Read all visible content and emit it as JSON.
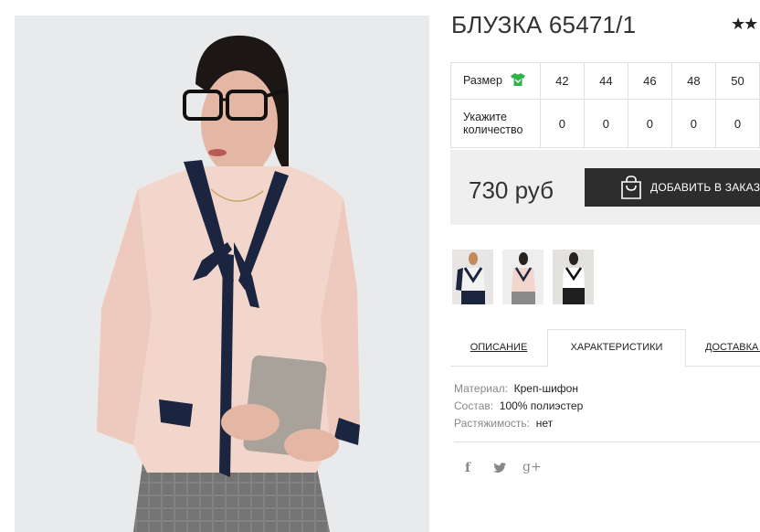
{
  "product": {
    "title": "БЛУЗКА 65471/1",
    "rating_stars": "★★"
  },
  "size_table": {
    "size_label": "Размер",
    "qty_label": "Укажите количество",
    "sizes": [
      "42",
      "44",
      "46",
      "48",
      "50"
    ],
    "quantities": [
      "0",
      "0",
      "0",
      "0",
      "0"
    ],
    "size_chart_icon": "shirt-icon"
  },
  "purchase": {
    "price": "730 руб",
    "order_button": "ДОБАВИТЬ В ЗАКАЗ",
    "order_icon": "shopping-bag-icon"
  },
  "tabs": [
    "ОПИСАНИЕ",
    "ХАРАКТЕРИСТИКИ",
    "ДОСТАВКА И"
  ],
  "active_tab": "ХАРАКТЕРИСТИКИ",
  "specs": [
    {
      "key": "Материал:",
      "value": "Креп-шифон"
    },
    {
      "key": "Состав:",
      "value": "100% полиэстер"
    },
    {
      "key": "Растяжимость:",
      "value": "нет"
    }
  ],
  "social": [
    "f",
    "twitter",
    "g+"
  ],
  "colors": {
    "accent_dark": "#2d2d2d",
    "price_box_bg": "#efefef",
    "size_icon_green": "#2fb34a",
    "blouse_pink": "#f2d5cb",
    "blouse_trim_navy": "#1b2540"
  }
}
